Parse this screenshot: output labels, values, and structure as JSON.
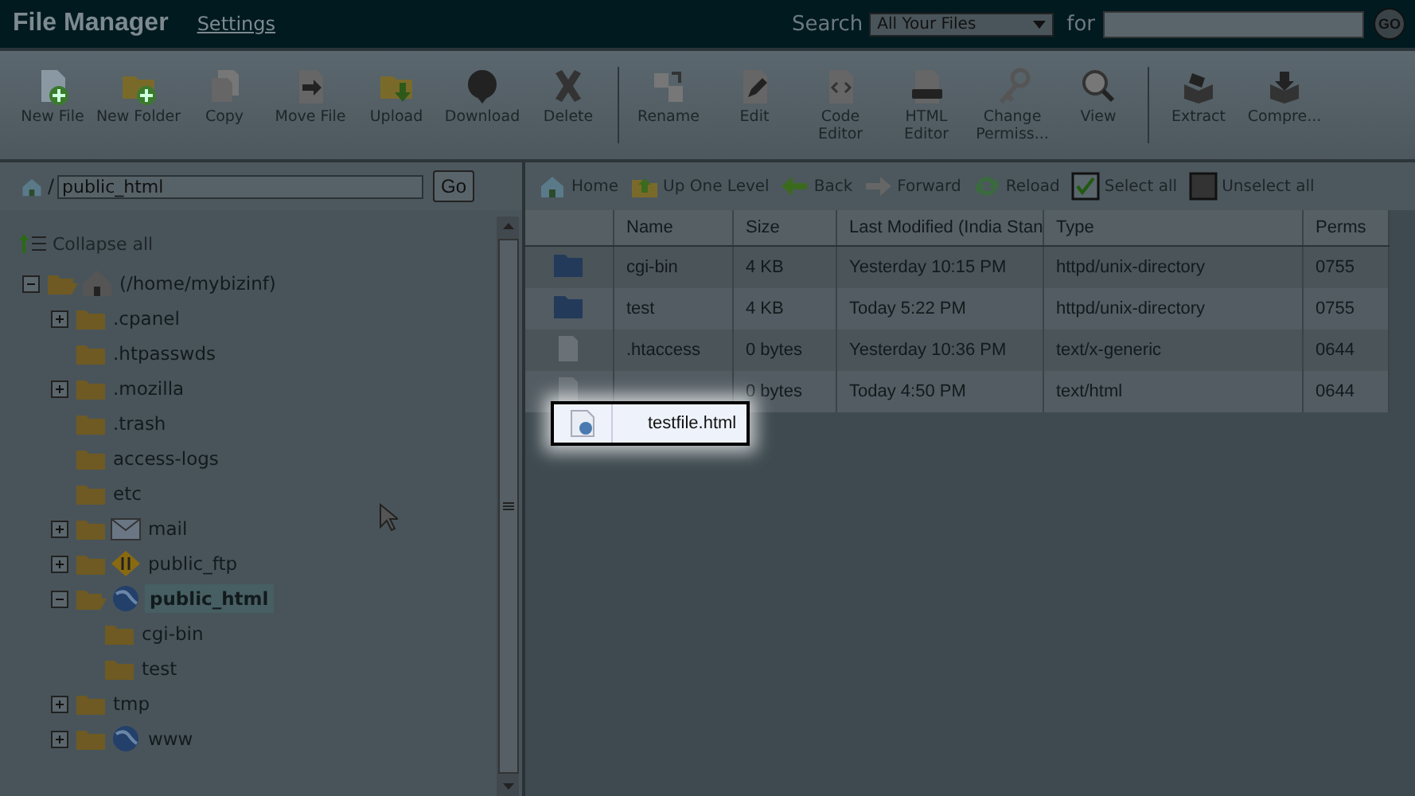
{
  "header": {
    "title": "File Manager",
    "settings_link": "Settings",
    "search_label": "Search",
    "search_scope": "All Your Files",
    "for_label": "for",
    "go_button": "GO"
  },
  "toolbar": {
    "groups": [
      [
        {
          "kind": "newfile",
          "label": "New File"
        },
        {
          "kind": "newfolder",
          "label": "New Folder"
        },
        {
          "kind": "copy",
          "label": "Copy"
        },
        {
          "kind": "move",
          "label": "Move File"
        },
        {
          "kind": "upload",
          "label": "Upload"
        },
        {
          "kind": "download",
          "label": "Download"
        },
        {
          "kind": "delete",
          "label": "Delete"
        }
      ],
      [
        {
          "kind": "rename",
          "label": "Rename"
        },
        {
          "kind": "edit",
          "label": "Edit"
        },
        {
          "kind": "code",
          "label": "Code Editor"
        },
        {
          "kind": "html",
          "label": "HTML Editor"
        },
        {
          "kind": "permissions",
          "label": "Change Permiss..."
        },
        {
          "kind": "view",
          "label": "View"
        }
      ],
      [
        {
          "kind": "extract",
          "label": "Extract"
        },
        {
          "kind": "compress",
          "label": "Compre..."
        }
      ]
    ]
  },
  "path_bar": {
    "separator": "/",
    "value": "public_html",
    "go_button": "Go"
  },
  "tree": {
    "collapse_all": "Collapse all",
    "root": {
      "label": "(/home/mybizinf)",
      "kind": "home",
      "expanded": true,
      "selected": false,
      "children": [
        {
          "label": ".cpanel",
          "kind": "folder",
          "expanded": false,
          "selected": false
        },
        {
          "label": ".htpasswds",
          "kind": "folder",
          "selected": false
        },
        {
          "label": ".mozilla",
          "kind": "folder",
          "expanded": false,
          "selected": false
        },
        {
          "label": ".trash",
          "kind": "folder",
          "selected": false
        },
        {
          "label": "access-logs",
          "kind": "folder",
          "selected": false
        },
        {
          "label": "etc",
          "kind": "folder",
          "selected": false
        },
        {
          "label": "mail",
          "kind": "mail",
          "expanded": false,
          "selected": false
        },
        {
          "label": "public_ftp",
          "kind": "ftp",
          "expanded": false,
          "selected": false
        },
        {
          "label": "public_html",
          "kind": "web",
          "expanded": true,
          "selected": true,
          "children": [
            {
              "label": "cgi-bin",
              "kind": "folder",
              "selected": false
            },
            {
              "label": "test",
              "kind": "folder",
              "selected": false
            }
          ]
        },
        {
          "label": "tmp",
          "kind": "folder",
          "expanded": false,
          "selected": false
        },
        {
          "label": "www",
          "kind": "web",
          "expanded": false,
          "selected": false
        }
      ]
    }
  },
  "nav": [
    {
      "kind": "home",
      "label": "Home"
    },
    {
      "kind": "up",
      "label": "Up One Level"
    },
    {
      "kind": "back",
      "label": "Back"
    },
    {
      "kind": "forward",
      "label": "Forward"
    },
    {
      "kind": "reload",
      "label": "Reload"
    },
    {
      "kind": "selectall",
      "label": "Select all"
    },
    {
      "kind": "unselectall",
      "label": "Unselect all"
    }
  ],
  "table": {
    "columns": [
      "Name",
      "Size",
      "Last Modified (India Stan",
      "Type",
      "Perms"
    ],
    "rows": [
      {
        "kind": "folder",
        "name": "cgi-bin",
        "size": "4 KB",
        "modified": "Yesterday 10:15 PM",
        "type": "httpd/unix-directory",
        "perms": "0755"
      },
      {
        "kind": "folder",
        "name": "test",
        "size": "4 KB",
        "modified": "Today 5:22 PM",
        "type": "httpd/unix-directory",
        "perms": "0755"
      },
      {
        "kind": "file",
        "name": ".htaccess",
        "size": "0 bytes",
        "modified": "Yesterday 10:36 PM",
        "type": "text/x-generic",
        "perms": "0644"
      },
      {
        "kind": "file",
        "size": "0 bytes",
        "modified": "Today 4:50 PM",
        "type": "text/html",
        "perms": "0644"
      }
    ]
  },
  "drag_item": {
    "name": "testfile.html"
  }
}
